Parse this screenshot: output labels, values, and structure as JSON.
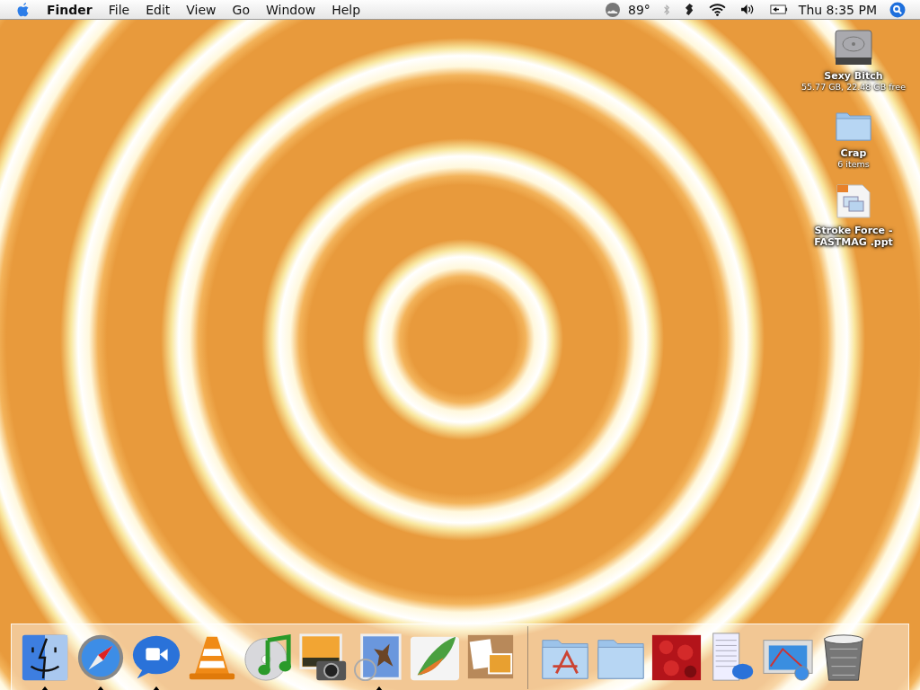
{
  "menu_bar": {
    "menus": [
      {
        "label": "Finder",
        "kind": "app"
      },
      {
        "label": "File",
        "kind": "menu"
      },
      {
        "label": "Edit",
        "kind": "menu"
      },
      {
        "label": "View",
        "kind": "menu"
      },
      {
        "label": "Go",
        "kind": "menu"
      },
      {
        "label": "Window",
        "kind": "menu"
      },
      {
        "label": "Help",
        "kind": "menu"
      }
    ],
    "status": [
      {
        "kind": "weather",
        "text": "89°"
      },
      {
        "kind": "bluetooth"
      },
      {
        "kind": "script"
      },
      {
        "kind": "wifi"
      },
      {
        "kind": "volume"
      },
      {
        "kind": "battery"
      },
      {
        "kind": "clock",
        "text": "Thu 8:35 PM"
      },
      {
        "kind": "spotlight"
      }
    ]
  },
  "desktop_icons": [
    {
      "kind": "drive",
      "name": "Sexy Bitch",
      "info": "55.77 GB, 22.48 GB free"
    },
    {
      "kind": "folder",
      "name": "Crap",
      "info": "6 items"
    },
    {
      "kind": "document",
      "name": "Stroke Force - FASTMAG .ppt"
    }
  ],
  "dock": {
    "apps": [
      {
        "kind": "finder",
        "running": true
      },
      {
        "kind": "compass",
        "running": true
      },
      {
        "kind": "video-chat",
        "running": true
      },
      {
        "kind": "cone",
        "running": false
      },
      {
        "kind": "music",
        "running": false
      },
      {
        "kind": "photo-camera",
        "running": false
      },
      {
        "kind": "stamp",
        "running": true
      },
      {
        "kind": "feather",
        "running": false
      },
      {
        "kind": "corkboard",
        "running": false
      }
    ],
    "stacks": [
      {
        "kind": "apps-folder"
      },
      {
        "kind": "folder"
      },
      {
        "kind": "photo"
      },
      {
        "kind": "chat-window"
      },
      {
        "kind": "browser-window"
      },
      {
        "kind": "trash"
      }
    ]
  }
}
